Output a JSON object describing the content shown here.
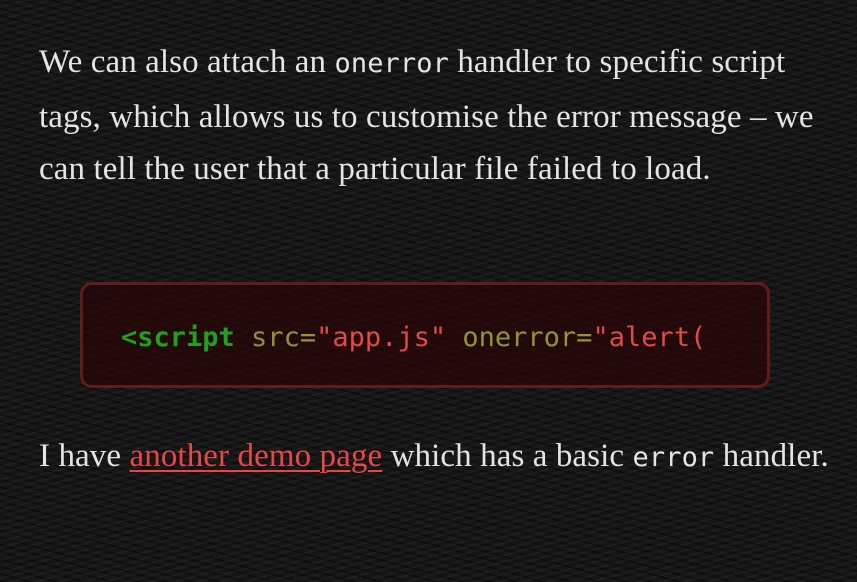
{
  "paragraph1": {
    "text_before": "We can also attach an ",
    "code": "onerror",
    "text_after": " handler to specific script tags, which allows us to customise the error message – we can tell the user that a particular file failed to load."
  },
  "code_block": {
    "tag": "<script",
    "attr1_name": " src=",
    "attr1_value": "\"app.js\"",
    "attr2_name": " onerror=",
    "attr2_value": "\"alert("
  },
  "paragraph2": {
    "text_before": "I have ",
    "link_text": "another demo page",
    "text_middle": " which has a basic ",
    "code": "error",
    "text_after": " handler."
  },
  "colors": {
    "background": "#161616",
    "text": "#e4e4e4",
    "link": "#e8474a",
    "code_tag": "#1fa01f",
    "code_attr": "#8f9436",
    "code_string": "#e14a4a",
    "code_block_border": "#5e1d1d"
  }
}
